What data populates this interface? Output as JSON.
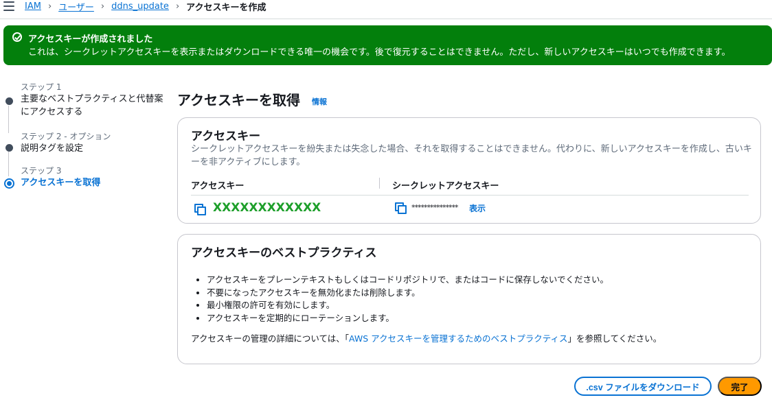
{
  "breadcrumb": {
    "items": [
      "IAM",
      "ユーザー",
      "ddns_update"
    ],
    "current": "アクセスキーを作成"
  },
  "flash": {
    "title": "アクセスキーが作成されました",
    "message": "これは、シークレットアクセスキーを表示またはダウンロードできる唯一の機会です。後で復元することはできません。ただし、新しいアクセスキーはいつでも作成できます。",
    "color": "#037f0c"
  },
  "steps": [
    {
      "num": "ステップ 1",
      "title": "主要なベストプラクティスと代替案にアクセスする",
      "title_line1": "主要なベストプラクティスと代替案",
      "title_line2": "にアクセスする",
      "active": false
    },
    {
      "num": "ステップ 2 - オプション",
      "title": "説明タグを設定",
      "active": false
    },
    {
      "num": "ステップ 3",
      "title": "アクセスキーを取得",
      "active": true
    }
  ],
  "page": {
    "title": "アクセスキーを取得",
    "info_link": "情報"
  },
  "access_key_panel": {
    "title": "アクセスキー",
    "description": "シークレットアクセスキーを紛失または失念した場合、それを取得することはできません。代わりに、新しいアクセスキーを作成し、古いキーを非アクティブにします。",
    "col_access_key": "アクセスキー",
    "col_secret_key": "シークレットアクセスキー",
    "access_key_value": "XXXXXXXXXXXX",
    "secret_mask": "***************",
    "show_link": "表示"
  },
  "best_practices_panel": {
    "title": "アクセスキーのベストプラクティス",
    "items": [
      "アクセスキーをプレーンテキストもしくはコードリポジトリで、またはコードに保存しないでください。",
      "不要になったアクセスキーを無効化または削除します。",
      "最小権限の許可を有効にします。",
      "アクセスキーを定期的にローテーションします。"
    ],
    "ref_prefix": "アクセスキーの管理の詳細については、「",
    "ref_link": "AWS アクセスキーを管理するためのベストプラクティス",
    "ref_suffix": "」を参照してください。"
  },
  "actions": {
    "download_csv": ".csv ファイルをダウンロード",
    "done": "完了"
  },
  "colors": {
    "primary_blue": "#0972d3",
    "success_green": "#037f0c",
    "done_orange": "#ff9900"
  }
}
